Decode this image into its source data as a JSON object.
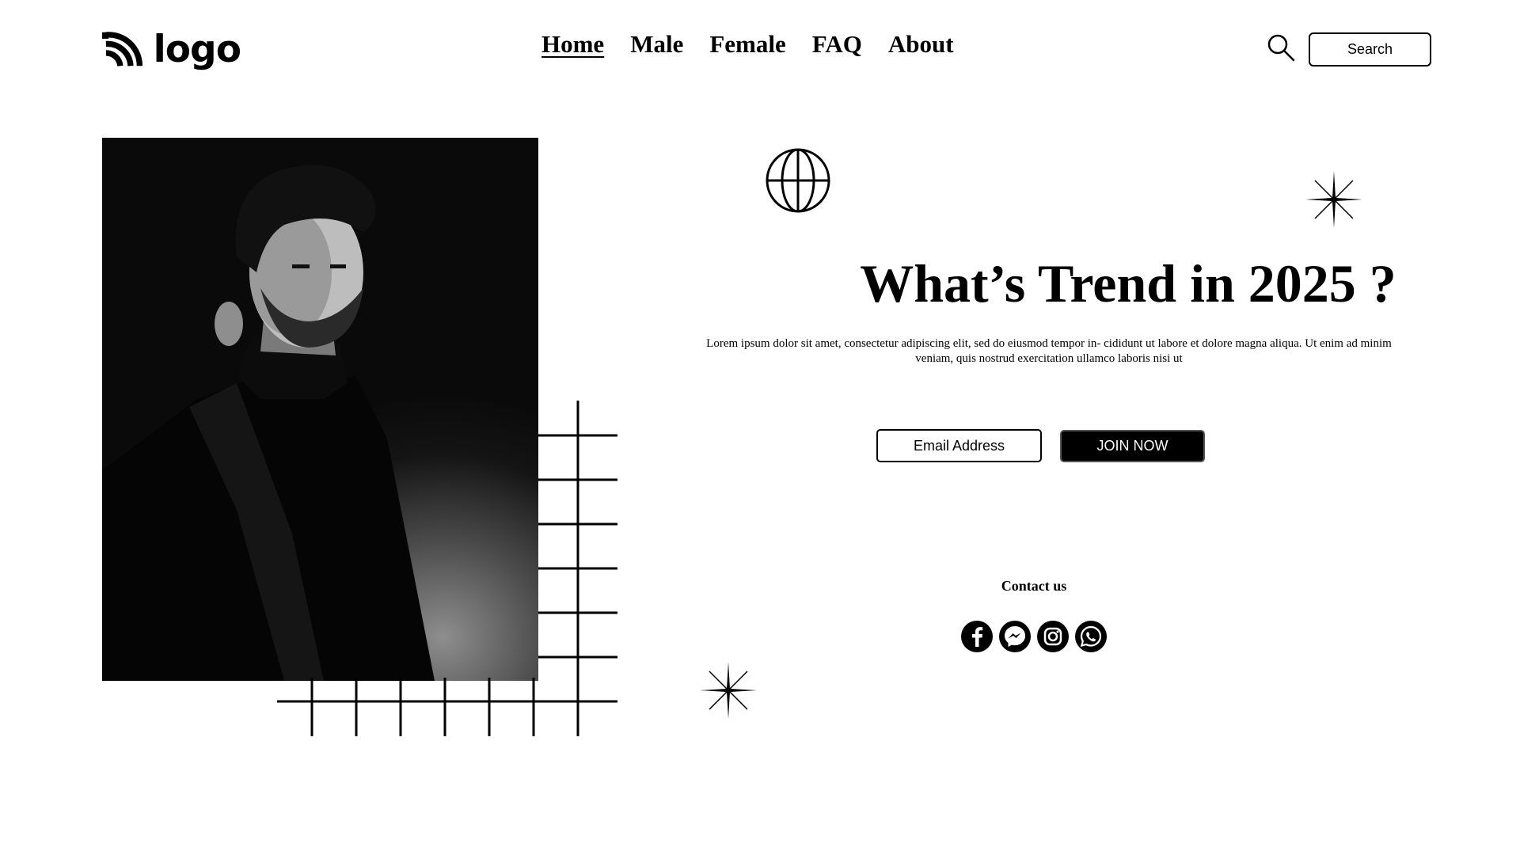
{
  "header": {
    "logo_text": "logo",
    "nav": [
      {
        "label": "Home",
        "active": true
      },
      {
        "label": "Male",
        "active": false
      },
      {
        "label": "Female",
        "active": false
      },
      {
        "label": "FAQ",
        "active": false
      },
      {
        "label": "About",
        "active": false
      }
    ],
    "search_button_label": "Search"
  },
  "hero": {
    "headline": "What’s Trend in 2025 ?",
    "description": "Lorem ipsum dolor sit amet, consectetur adipiscing elit, sed do eiusmod tempor in- cididunt ut labore et dolore magna aliqua. Ut enim ad minim veniam, quis nostrud exercitation ullamco laboris nisi ut",
    "email_placeholder": "Email Address",
    "join_button_label": "JOIN NOW"
  },
  "contact": {
    "label": "Contact us",
    "social_icons": [
      "facebook-icon",
      "messenger-icon",
      "instagram-icon",
      "whatsapp-icon"
    ]
  },
  "decor_icons": [
    "globe-icon",
    "sparkle-icon",
    "grid-decoration"
  ],
  "colors": {
    "primary": "#000000",
    "background": "#ffffff"
  }
}
